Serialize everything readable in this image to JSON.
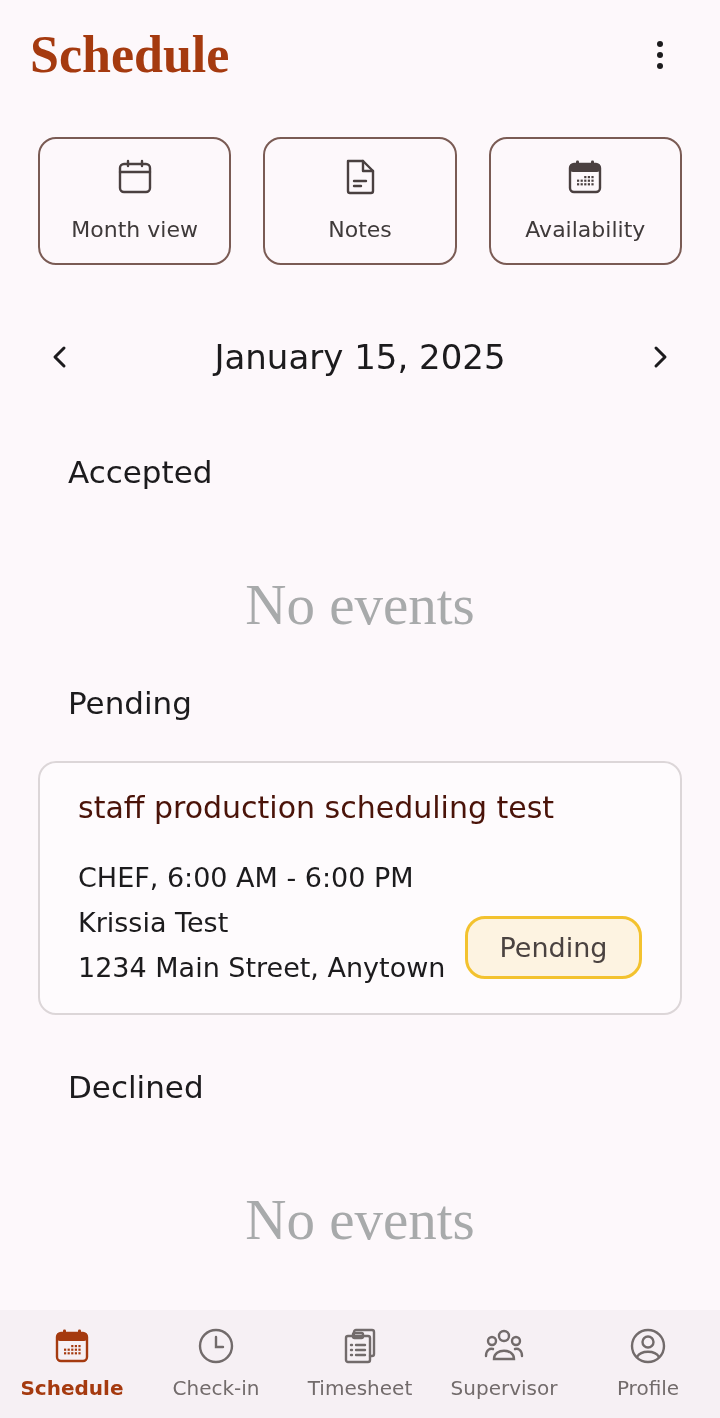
{
  "header": {
    "title": "Schedule"
  },
  "quick_actions": [
    {
      "label": "Month view"
    },
    {
      "label": "Notes"
    },
    {
      "label": "Availability"
    }
  ],
  "date_nav": {
    "date": "January 15, 2025"
  },
  "sections": [
    {
      "heading": "Accepted",
      "empty_text": "No events"
    },
    {
      "heading": "Pending",
      "events": [
        {
          "title": "staff production scheduling test",
          "role_time": "CHEF, 6:00 AM - 6:00 PM",
          "person": "Krissia Test",
          "address": "1234 Main Street, Anytown",
          "status": "Pending"
        }
      ]
    },
    {
      "heading": "Declined",
      "empty_text": "No events"
    }
  ],
  "bottom_nav": [
    {
      "label": "Schedule",
      "selected": true
    },
    {
      "label": "Check-in",
      "selected": false
    },
    {
      "label": "Timesheet",
      "selected": false
    },
    {
      "label": "Supervisor",
      "selected": false
    },
    {
      "label": "Profile",
      "selected": false
    }
  ]
}
